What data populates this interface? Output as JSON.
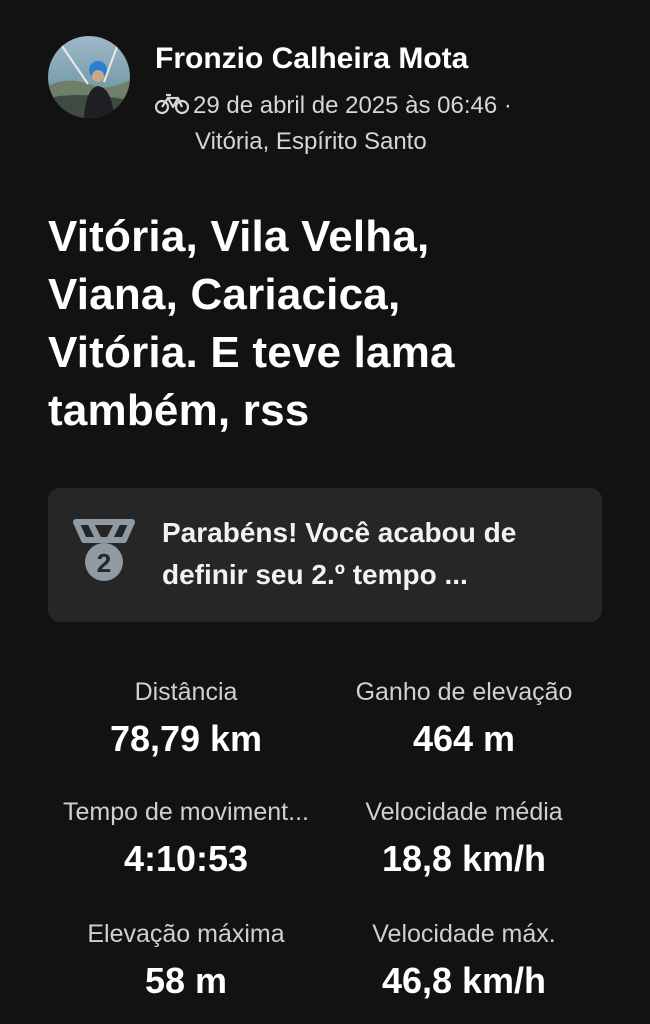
{
  "header": {
    "athlete_name": "Fronzio Calheira Mota",
    "activity_icon": "bike-icon",
    "date_time": "29 de abril de 2025 às 06:46 ·",
    "location": "Vitória, Espírito Santo"
  },
  "activity": {
    "title": "Vitória, Vila Velha,\nViana, Cariacica,\nVitória. E teve lama\ntambém,  rss"
  },
  "achievement": {
    "icon": "medal-icon",
    "rank_number": "2",
    "text": "Parabéns! Você acabou de definir seu 2.º tempo ..."
  },
  "stats": [
    {
      "label": "Distância",
      "value": "78,79 km"
    },
    {
      "label": "Ganho de elevação",
      "value": "464 m"
    },
    {
      "label": "Tempo de moviment...",
      "value": "4:10:53"
    },
    {
      "label": "Velocidade média",
      "value": "18,8 km/h"
    },
    {
      "label": "Elevação máxima",
      "value": "58 m"
    },
    {
      "label": "Velocidade máx.",
      "value": "46,8 km/h"
    }
  ],
  "colors": {
    "background": "#121212",
    "card": "#262626",
    "medal": "#8f9aa3"
  }
}
